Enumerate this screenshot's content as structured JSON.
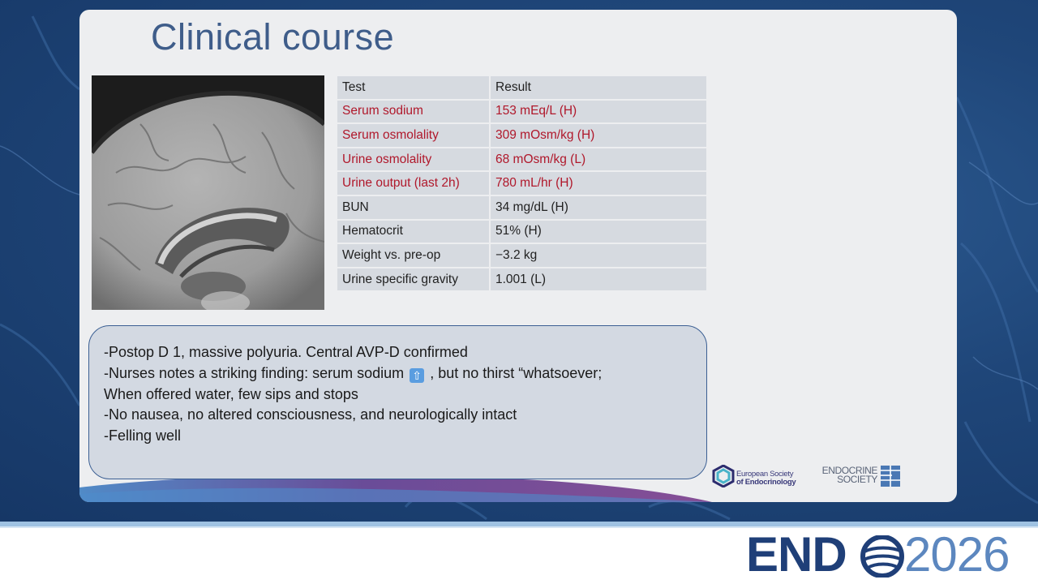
{
  "slide": {
    "title": "Clinical course"
  },
  "results_table": {
    "headers": [
      "Test",
      "Result"
    ],
    "rows": [
      {
        "test": "Serum sodium",
        "result": "153 mEq/L (H)",
        "abnormal": true
      },
      {
        "test": "Serum osmolality",
        "result": "309 mOsm/kg (H)",
        "abnormal": true
      },
      {
        "test": "Urine osmolality",
        "result": "68 mOsm/kg (L)",
        "abnormal": true
      },
      {
        "test": "Urine output (last 2h)",
        "result": "780 mL/hr (H)",
        "abnormal": true
      },
      {
        "test": "BUN",
        "result": "34 mg/dL (H)",
        "abnormal": false
      },
      {
        "test": "Hematocrit",
        "result": "51% (H)",
        "abnormal": false
      },
      {
        "test": "Weight vs. pre-op",
        "result": "−3.2 kg",
        "abnormal": false
      },
      {
        "test": "Urine specific gravity",
        "result": "1.001 (L)",
        "abnormal": false
      }
    ],
    "abnormal_color": "#b0182b"
  },
  "notes": {
    "line1": "-Postop D 1, massive polyuria. Central AVP-D confirmed",
    "line2_before": "-Nurses notes a striking finding: serum sodium",
    "line2_icon": "up-arrow-icon",
    "line2_after": ", but no thirst “whatsoever;",
    "line3": "When offered water, few sips and stops",
    "line4": "-No nausea, no altered consciousness, and neurologically intact",
    "line5": "-Felling well"
  },
  "logos": {
    "ese_line1": "European Society",
    "ese_line2": "of Endocrinology",
    "es_line1": "ENDOCRINE",
    "es_line2": "SOCIETY"
  },
  "brand": {
    "word": "END",
    "year": "2026",
    "primary_color": "#1f3f78",
    "accent_color": "#5c87bf"
  }
}
